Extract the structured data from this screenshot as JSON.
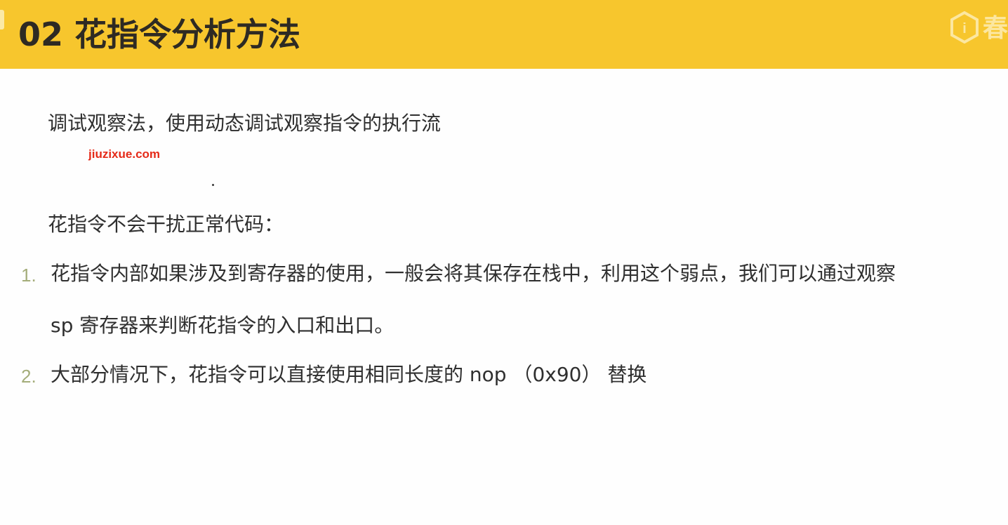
{
  "header": {
    "title": "02 花指令分析方法",
    "logo_text": "i",
    "logo_glyph": "春",
    "logo_icon": "brand-logo-icon",
    "accent_color": "#f7c62d"
  },
  "content": {
    "intro": "调试观察法，使用动态调试观察指令的执行流",
    "watermark": "jiuzixue.com",
    "subheading": "花指令不会干扰正常代码：",
    "items": [
      {
        "number": "1.",
        "line1": "花指令内部如果涉及到寄存器的使用，一般会将其保存在栈中，利用这个弱点，我们可以通过观察",
        "line2": "sp 寄存器来判断花指令的入口和出口。"
      },
      {
        "number": "2.",
        "line1": "大部分情况下，花指令可以直接使用相同长度的 nop （0x90） 替换"
      }
    ]
  }
}
